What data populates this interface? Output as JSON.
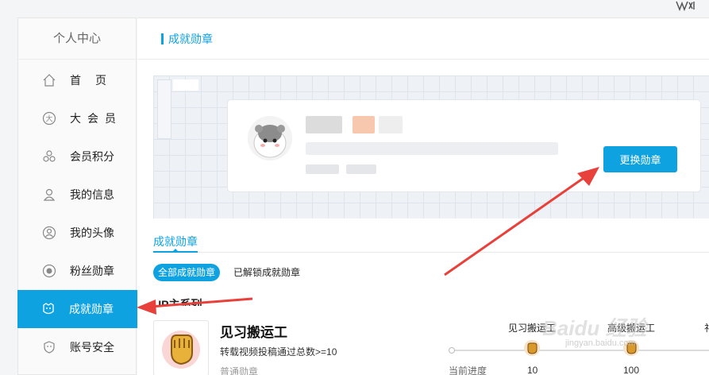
{
  "sidebar": {
    "title": "个人中心",
    "items": [
      {
        "label": "首页",
        "icon": "home-icon"
      },
      {
        "label": "大会员",
        "icon": "vip-icon"
      },
      {
        "label": "会员积分",
        "icon": "points-icon"
      },
      {
        "label": "我的信息",
        "icon": "user-info-icon"
      },
      {
        "label": "我的头像",
        "icon": "avatar-icon"
      },
      {
        "label": "粉丝勋章",
        "icon": "fan-medal-icon"
      },
      {
        "label": "成就勋章",
        "icon": "achievement-icon"
      },
      {
        "label": "账号安全",
        "icon": "shield-icon"
      }
    ],
    "active_index": 6
  },
  "header": {
    "title": "成就勋章"
  },
  "profile_card": {
    "change_button": "更换勋章"
  },
  "tabs": {
    "main": "成就勋章"
  },
  "filters": {
    "all": "全部成就勋章",
    "unlocked": "已解锁成就勋章"
  },
  "series": {
    "title": "UP主系列"
  },
  "badge": {
    "name": "见习搬运工",
    "description": "转载视频投稿通过总数>=10",
    "type": "普通勋章",
    "progress_label": "当前进度",
    "levels": [
      {
        "name": "见习搬运工",
        "value": "10"
      },
      {
        "name": "高级搬运工",
        "value": "100"
      },
      {
        "name": "礼",
        "value": ""
      }
    ]
  },
  "watermark": {
    "main": "Baidu 经验",
    "sub": "jingyan.baidu.com"
  },
  "colors": {
    "accent": "#0fa2e0",
    "arrow": "#e8403a"
  }
}
